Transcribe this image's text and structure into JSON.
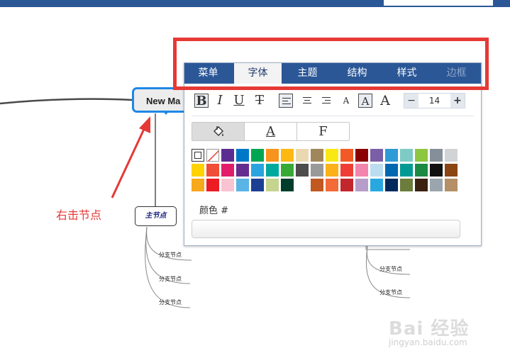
{
  "mindmap": {
    "root_label": "New Ma",
    "main_node_label": "主节点",
    "branch_label": "分支节点",
    "annotation": "右击节点"
  },
  "panel": {
    "tabs": [
      {
        "label": "菜单"
      },
      {
        "label": "字体"
      },
      {
        "label": "主题"
      },
      {
        "label": "结构"
      },
      {
        "label": "样式"
      },
      {
        "label": "边框"
      }
    ],
    "active_tab": "字体",
    "toolbar": {
      "bold": "B",
      "italic": "I",
      "underline": "U",
      "strike": "T",
      "small_a": "A",
      "box_a": "A",
      "large_a": "A",
      "font_size": "14",
      "minus": "−",
      "plus": "+"
    },
    "modes": [
      {
        "label": "fill",
        "icon": "paint-bucket-icon"
      },
      {
        "label": "A"
      },
      {
        "label": "F"
      }
    ],
    "swatches_row1": [
      "#ffffff",
      "none",
      "#5c2d91",
      "#0078c8",
      "#00a651",
      "#f7941d",
      "#fdb813",
      "#ead8b1",
      "#a0875b",
      "#f9e814",
      "#f15a24",
      "#8b0000",
      "#7b5ea7",
      "#2e9ad6",
      "#7dcbc4",
      "#8dc63f",
      "#848f99",
      "#d1d3d4"
    ],
    "swatches_row2": [
      "#ffd200",
      "#f04e37",
      "#e01c6b",
      "#662d91",
      "#2aa4e0",
      "#00a99d",
      "#39a935",
      "#4d4d4d",
      "#999999",
      "#fbb117",
      "#ef3e36",
      "#f384ad",
      "#bcdcf0",
      "#0067b1",
      "#009a93",
      "#1b8a43",
      "#111111",
      "#8b4513"
    ],
    "swatches_row3": [
      "#f7a81b",
      "#ed1c24",
      "#f9c3d2",
      "#5ab4e5",
      "#1c3f94",
      "#c5d48f",
      "#003d2b",
      "#ffffff",
      "#c1581f",
      "#f26b38",
      "#c1272d",
      "#b79dc9",
      "#29a8e0",
      "#002a5c",
      "#6b7c3b",
      "#3a2110",
      "#9aa5ad",
      "#b58f66"
    ],
    "color_label": "颜色 #",
    "color_value": ""
  },
  "watermark": {
    "logo": "Bai 经验",
    "url": "jingyan.baidu.com"
  }
}
